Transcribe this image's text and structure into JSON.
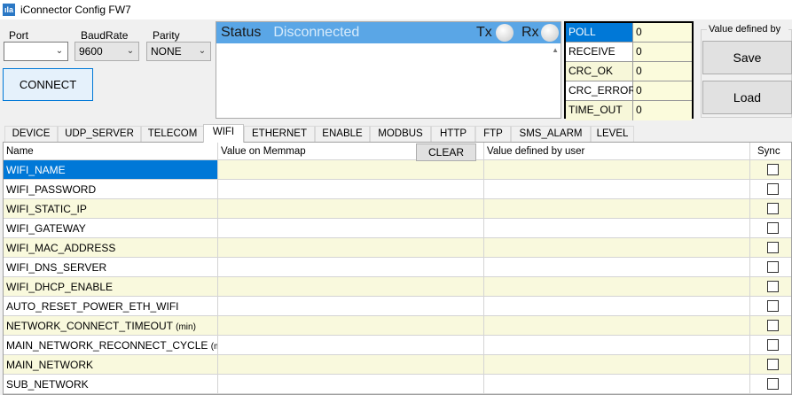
{
  "window": {
    "icon_text": "ıla",
    "title": "iConnector Config FW7"
  },
  "serial": {
    "port_label": "Port",
    "port_value": "",
    "baudrate_label": "BaudRate",
    "baudrate_value": "9600",
    "parity_label": "Parity",
    "parity_value": "NONE",
    "connect_label": "CONNECT"
  },
  "status": {
    "label": "Status",
    "value": "Disconnected",
    "tx_label": "Tx",
    "rx_label": "Rx"
  },
  "counters": [
    {
      "name": "POLL",
      "value": "0"
    },
    {
      "name": "RECEIVE",
      "value": "0"
    },
    {
      "name": "CRC_OK",
      "value": "0"
    },
    {
      "name": "CRC_ERROR",
      "value": "0"
    },
    {
      "name": "TIME_OUT",
      "value": "0"
    }
  ],
  "user_group": {
    "label": "Value defined by user",
    "save_label": "Save",
    "load_label": "Load"
  },
  "tabs": [
    "DEVICE",
    "UDP_SERVER",
    "TELECOM",
    "WIFI",
    "ETHERNET",
    "ENABLE",
    "MODBUS",
    "HTTP",
    "FTP",
    "SMS_ALARM",
    "LEVEL"
  ],
  "active_tab": "WIFI",
  "grid": {
    "headers": {
      "name": "Name",
      "memmap": "Value on Memmap",
      "clear": "CLEAR",
      "user": "Value defined by user",
      "sync": "Sync"
    },
    "rows": [
      {
        "name": "WIFI_NAME",
        "unit": ""
      },
      {
        "name": "WIFI_PASSWORD",
        "unit": ""
      },
      {
        "name": "WIFI_STATIC_IP",
        "unit": ""
      },
      {
        "name": "WIFI_GATEWAY",
        "unit": ""
      },
      {
        "name": "WIFI_MAC_ADDRESS",
        "unit": ""
      },
      {
        "name": "WIFI_DNS_SERVER",
        "unit": ""
      },
      {
        "name": "WIFI_DHCP_ENABLE",
        "unit": ""
      },
      {
        "name": "AUTO_RESET_POWER_ETH_WIFI",
        "unit": ""
      },
      {
        "name": "NETWORK_CONNECT_TIMEOUT",
        "unit": "(min)"
      },
      {
        "name": "MAIN_NETWORK_RECONNECT_CYCLE",
        "unit": "(min)"
      },
      {
        "name": "MAIN_NETWORK",
        "unit": ""
      },
      {
        "name": "SUB_NETWORK",
        "unit": ""
      }
    ]
  }
}
